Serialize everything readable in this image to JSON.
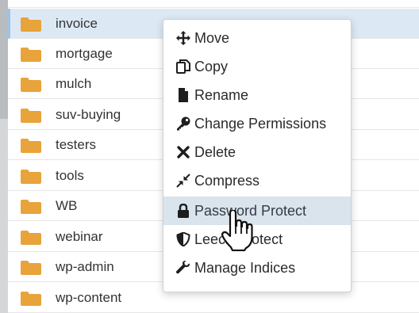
{
  "file_manager": {
    "folders": [
      {
        "name": "invoice",
        "selected": true
      },
      {
        "name": "mortgage"
      },
      {
        "name": "mulch"
      },
      {
        "name": "suv-buying"
      },
      {
        "name": "testers"
      },
      {
        "name": "tools"
      },
      {
        "name": "WB"
      },
      {
        "name": "webinar"
      },
      {
        "name": "wp-admin"
      },
      {
        "name": "wp-content"
      }
    ],
    "folder_icon": "folder-icon",
    "folder_color": "#e8a33b"
  },
  "context_menu": {
    "items": [
      {
        "label": "Move",
        "icon": "move-icon"
      },
      {
        "label": "Copy",
        "icon": "copy-icon"
      },
      {
        "label": "Rename",
        "icon": "file-icon"
      },
      {
        "label": "Change Permissions",
        "icon": "key-icon"
      },
      {
        "label": "Delete",
        "icon": "delete-icon"
      },
      {
        "label": "Compress",
        "icon": "compress-icon"
      },
      {
        "label": "Password Protect",
        "icon": "lock-icon",
        "hovered": true
      },
      {
        "label": "Leech Protect",
        "icon": "shield-icon"
      },
      {
        "label": "Manage Indices",
        "icon": "wrench-icon"
      }
    ],
    "hover_color": "#d9e4ec"
  },
  "cursor": {
    "icon": "hand-pointer-icon"
  }
}
